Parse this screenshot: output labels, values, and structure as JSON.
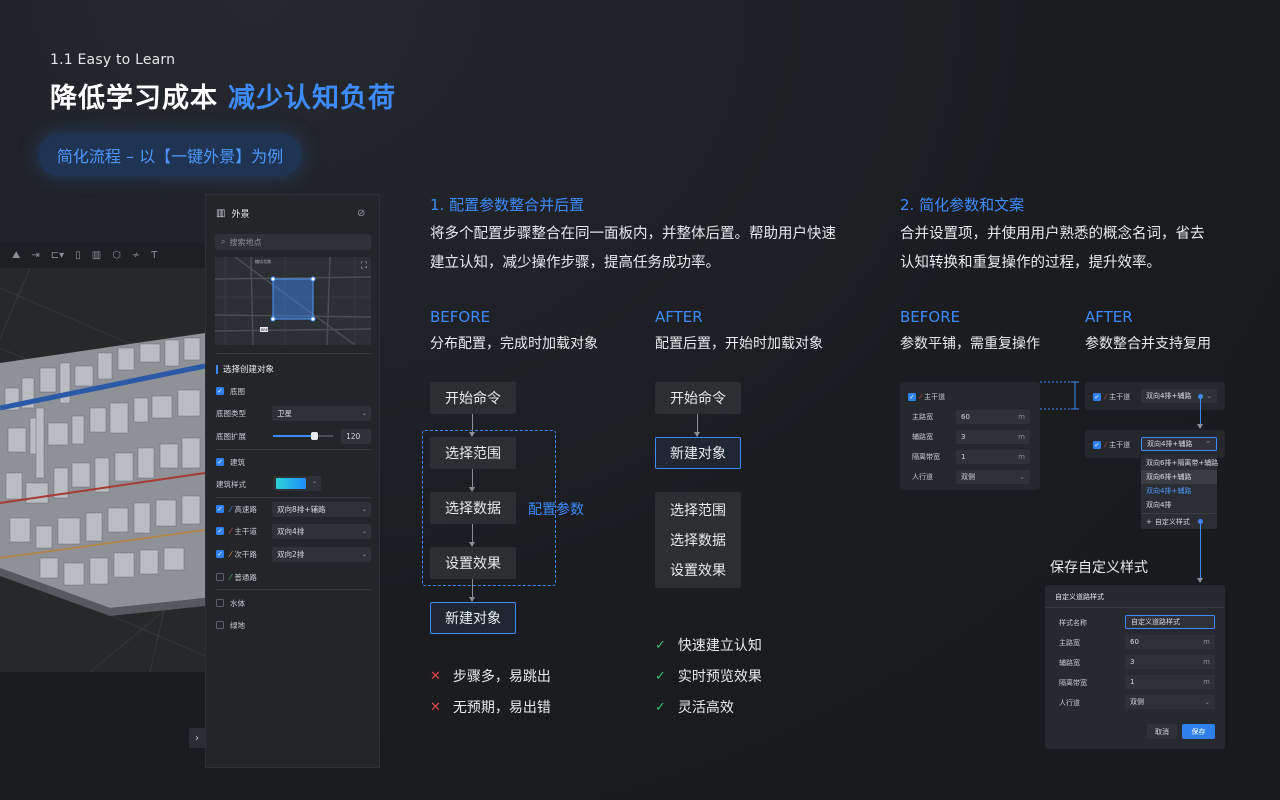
{
  "header": {
    "section_label": "1.1 Easy to Learn",
    "title_main": "降低学习成本",
    "title_highlight": "减少认知负荷",
    "pill": "简化流程 – 以【一键外景】为例"
  },
  "colors": {
    "accent": "#3d8bfd",
    "bg": "#1a1c20",
    "error": "#e5484d",
    "success": "#3fbf74"
  },
  "panel": {
    "title": "外景",
    "search_placeholder": "搜索地点",
    "map_label_top": "糖坊北路",
    "map_label_bottom": "BRE",
    "section": "选择创建对象",
    "basemap": {
      "label": "底图",
      "type_label": "底图类型",
      "type_value": "卫星",
      "extend_label": "底图扩展",
      "extend_value": "120",
      "slider_value": 0.66
    },
    "building": {
      "label": "建筑",
      "style_label": "建筑样式"
    },
    "roads": [
      {
        "label": "高速路",
        "value": "双向8排+辅路",
        "checked": true,
        "icon_color": "blue"
      },
      {
        "label": "主干道",
        "value": "双向4排",
        "checked": true,
        "icon_color": "red"
      },
      {
        "label": "次干路",
        "value": "双向2排",
        "checked": true,
        "icon_color": "orange"
      },
      {
        "label": "普通路",
        "value": "",
        "checked": false,
        "icon_color": "green"
      }
    ],
    "water": "水体",
    "green": "绿地"
  },
  "section1": {
    "heading": "1. 配置参数整合并后置",
    "desc_line1": "将多个配置步骤整合在同一面板内，并整体后置。帮助用户快速",
    "desc_line2": "建立认知，减少操作步骤，提高任务成功率。",
    "before": {
      "label": "BEFORE",
      "sub": "分布配置，完成时加载对象",
      "steps": [
        "开始命令",
        "选择范围",
        "选择数据",
        "设置效果",
        "新建对象"
      ],
      "group_label": "配置参数",
      "cons": [
        "步骤多，易跳出",
        "无预期，易出错"
      ]
    },
    "after": {
      "label": "AFTER",
      "sub": "配置后置，开始时加载对象",
      "steps": [
        "开始命令",
        "新建对象"
      ],
      "grouped_steps": [
        "选择范围",
        "选择数据",
        "设置效果"
      ],
      "pros": [
        "快速建立认知",
        "实时预览效果",
        "灵活高效"
      ]
    }
  },
  "section2": {
    "heading": "2. 简化参数和文案",
    "desc_line1": "合并设置项，并使用用户熟悉的概念名词，省去",
    "desc_line2": "认知转换和重复操作的过程，提升效率。",
    "before": {
      "label": "BEFORE",
      "sub": "参数平铺，需重复操作",
      "road_label": "主干道",
      "fields": [
        {
          "label": "主路宽",
          "value": "60",
          "unit": "m"
        },
        {
          "label": "辅路宽",
          "value": "3",
          "unit": "m"
        },
        {
          "label": "隔离带宽",
          "value": "1",
          "unit": "m"
        },
        {
          "label": "人行道",
          "value": "双侧",
          "unit": ""
        }
      ]
    },
    "after": {
      "label": "AFTER",
      "sub": "参数整合并支持复用",
      "road_label": "主干道",
      "selected": "双向4排+辅路",
      "options": [
        "双向6排+隔离带+辅路",
        "双向6排+辅路",
        "双向4排+辅路",
        "双向4排"
      ],
      "custom_option": "自定义样式"
    },
    "save": {
      "caption": "保存自定义样式",
      "dialog_title": "自定义道路样式",
      "name_label": "样式名称",
      "name_value": "自定义道路样式",
      "fields": [
        {
          "label": "主路宽",
          "value": "60",
          "unit": "m"
        },
        {
          "label": "辅路宽",
          "value": "3",
          "unit": "m"
        },
        {
          "label": "隔离带宽",
          "value": "1",
          "unit": "m"
        },
        {
          "label": "人行道",
          "value": "双侧",
          "unit": ""
        }
      ],
      "cancel": "取消",
      "save": "保存"
    }
  }
}
